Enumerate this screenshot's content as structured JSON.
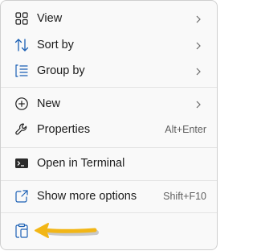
{
  "menu": {
    "items": [
      {
        "label": "View",
        "icon": "view-grid-icon",
        "submenu": true
      },
      {
        "label": "Sort by",
        "icon": "sort-icon",
        "submenu": true
      },
      {
        "label": "Group by",
        "icon": "group-by-icon",
        "submenu": true
      },
      {
        "label": "New",
        "icon": "new-plus-icon",
        "submenu": true
      },
      {
        "label": "Properties",
        "icon": "wrench-icon",
        "shortcut": "Alt+Enter"
      },
      {
        "label": "Open in Terminal",
        "icon": "terminal-icon"
      },
      {
        "label": "Show more options",
        "icon": "show-more-options-icon",
        "shortcut": "Shift+F10"
      }
    ],
    "bottom_bar": {
      "icon": "paste-icon"
    }
  },
  "annotation": {
    "icon": "yellow-arrow-icon",
    "color": "#f2b616"
  },
  "colors": {
    "icon_blue": "#1a5fb4",
    "menu_bg": "#f9f9f9",
    "separator": "#e3e3e3"
  }
}
